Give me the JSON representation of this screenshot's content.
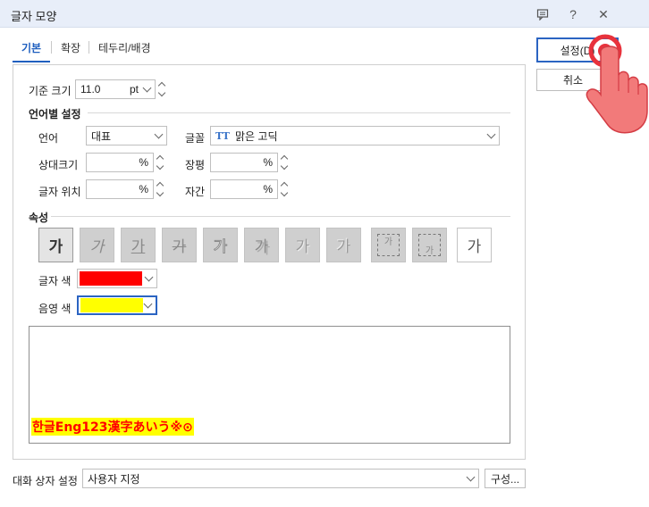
{
  "window": {
    "title": "글자 모양",
    "help_label": "?",
    "close_label": "✕"
  },
  "tabs": [
    {
      "label": "기본"
    },
    {
      "label": "확장"
    },
    {
      "label": "테두리/배경"
    }
  ],
  "basic": {
    "size_label": "기준 크기",
    "size_value": "11.0",
    "size_unit": "pt",
    "lang_section": "언어별 설정",
    "lang_label": "언어",
    "lang_value": "대표",
    "font_label": "글꼴",
    "font_value": "맑은 고딕",
    "font_type_icon": "TT",
    "rel_size_label": "상대크기",
    "rel_size_value": "",
    "rel_size_unit": "%",
    "width_label": "장평",
    "width_value": "",
    "width_unit": "%",
    "pos_label": "글자 위치",
    "pos_value": "",
    "pos_unit": "%",
    "spacing_label": "자간",
    "spacing_value": "",
    "spacing_unit": "%",
    "attr_section": "속성",
    "attrs": [
      "가",
      "가",
      "가",
      "가",
      "가",
      "가",
      "가",
      "가",
      "가",
      "가",
      "가"
    ],
    "text_color_label": "글자 색",
    "text_color": "#ff0000",
    "shade_color_label": "음영 색",
    "shade_color": "#ffff00",
    "preview_text": "한글Eng123漢字あいう※⊙"
  },
  "buttons": {
    "ok": "설정(D)",
    "cancel": "취소",
    "compose": "구성..."
  },
  "dialog_settings": {
    "label": "대화 상자 설정",
    "value": "사용자 지정"
  },
  "colors": {
    "accent": "#1f5fbf",
    "titlebar": "#e8eef9"
  }
}
